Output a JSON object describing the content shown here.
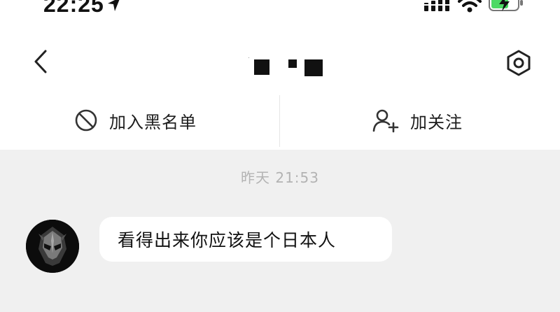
{
  "status_bar": {
    "time": "22:25",
    "icons": [
      "location-arrow-icon",
      "cellular-signal-icon",
      "wifi-icon",
      "battery-charging-icon"
    ],
    "battery_color": "#4cd964"
  },
  "nav": {
    "back_icon": "chevron-left-icon",
    "title_redacted": true,
    "settings_icon": "settings-hexagon-icon"
  },
  "actions": {
    "block": {
      "icon": "block-circle-icon",
      "label": "加入黑名单"
    },
    "follow": {
      "icon": "add-user-icon",
      "label": "加关注"
    }
  },
  "chat": {
    "timestamp": "昨天 21:53",
    "messages": [
      {
        "sender": "other",
        "avatar_icon": "dark-helmet-avatar",
        "text": "看得出来你应该是个日本人"
      }
    ]
  },
  "colors": {
    "chat_background": "#f0f0f0",
    "bubble_background": "#ffffff",
    "timestamp_text": "#b3b3b3",
    "primary_text": "#1a1a1a"
  }
}
